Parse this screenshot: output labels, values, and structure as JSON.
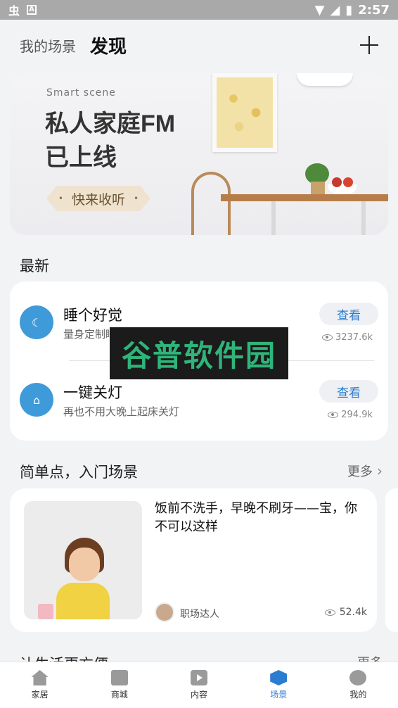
{
  "status_bar": {
    "time": "2:57"
  },
  "header": {
    "tab_mine": "我的场景",
    "tab_discover": "发现"
  },
  "banner": {
    "tagline": "Smart scene",
    "title_line1": "私人家庭FM",
    "title_line2": "已上线",
    "button": "快来收听"
  },
  "latest": {
    "title": "最新",
    "items": [
      {
        "name": "睡个好觉",
        "desc": "量身定制睡眠环境，减少压力，轻松身心",
        "action": "查看",
        "views": "3237.6k",
        "icon": "moon-icon"
      },
      {
        "name": "一键关灯",
        "desc": "再也不用大晚上起床关灯",
        "action": "查看",
        "views": "294.9k",
        "icon": "lamp-icon"
      }
    ]
  },
  "simple": {
    "title": "简单点，入门场景",
    "more": "更多",
    "card": {
      "title": "饭前不洗手，早晚不刷牙——宝，你不可以这样",
      "author": "职场达人",
      "views": "52.4k"
    }
  },
  "next_section": {
    "title": "让生活更方便",
    "more": "更多"
  },
  "watermark": {
    "text": "谷普软件园"
  },
  "bottom_nav": [
    {
      "label": "家居",
      "icon": "home-icon"
    },
    {
      "label": "商城",
      "icon": "shop-icon"
    },
    {
      "label": "内容",
      "icon": "play-icon"
    },
    {
      "label": "场景",
      "icon": "scene-cube-icon",
      "active": true
    },
    {
      "label": "我的",
      "icon": "profile-icon"
    }
  ]
}
